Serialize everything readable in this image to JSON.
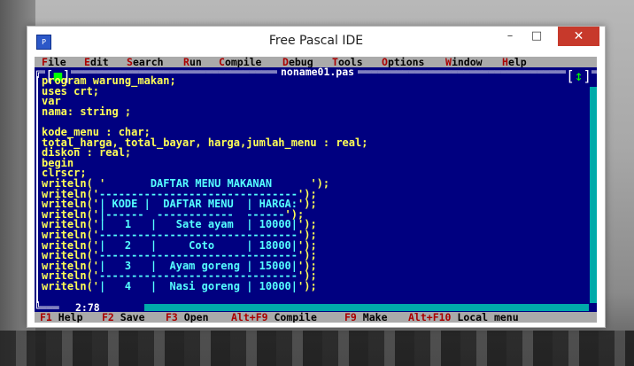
{
  "window": {
    "title": "Free Pascal IDE",
    "icon": "free-pascal-app-icon",
    "minimize": "–",
    "maximize": "□",
    "close": "✕"
  },
  "menu": [
    {
      "hotkey": "F",
      "rest": "ile"
    },
    {
      "hotkey": "E",
      "rest": "dit"
    },
    {
      "hotkey": "S",
      "rest": "earch"
    },
    {
      "hotkey": "R",
      "rest": "un"
    },
    {
      "hotkey": "C",
      "rest": "ompile"
    },
    {
      "hotkey": "D",
      "rest": "ebug"
    },
    {
      "hotkey": "T",
      "rest": "ools"
    },
    {
      "hotkey": "O",
      "rest": "ptions"
    },
    {
      "hotkey": "W",
      "rest": "indow"
    },
    {
      "hotkey": "H",
      "rest": "elp"
    }
  ],
  "editor": {
    "filename": "noname01.pas",
    "close_box": "■",
    "zoom_box": "↕",
    "cursor_pos": "2:78",
    "lines": [
      "program warung_makan;",
      "uses crt;",
      "var",
      "nama: string ;",
      "",
      "kode_menu : char;",
      "total_harga, total_bayar, harga,jumlah_menu : real;",
      "diskon : real;",
      "begin",
      "clrscr;",
      "writeln( '       DAFTAR MENU MAKANAN      ');",
      "writeln('-------------------------------');",
      "writeln('| KODE |  DAFTAR MENU  | HARGA:');",
      "writeln('|------  ------------  ------');",
      "writeln('|   1   |   Sate ayam  | 10000|');",
      "writeln('-------------------------------');",
      "writeln('|   2   |     Coto     | 18000|');",
      "writeln('-------------------------------');",
      "writeln('|   3   |  Ayam goreng | 15000|');",
      "writeln('-------------------------------');",
      "writeln('|   4   |  Nasi goreng | 10000|');"
    ]
  },
  "status": [
    {
      "key": "F1",
      "label": "Help"
    },
    {
      "key": "F2",
      "label": "Save"
    },
    {
      "key": "F3",
      "label": "Open"
    },
    {
      "key": "Alt+F9",
      "label": "Compile"
    },
    {
      "key": "F9",
      "label": "Make"
    },
    {
      "key": "Alt+F10",
      "label": "Local menu"
    }
  ],
  "colors": {
    "editor_bg": "#000080",
    "code_text": "#ffff55",
    "string_text": "#55ffff",
    "menubar_bg": "#aaaaaa",
    "hotkey": "#aa0000"
  }
}
